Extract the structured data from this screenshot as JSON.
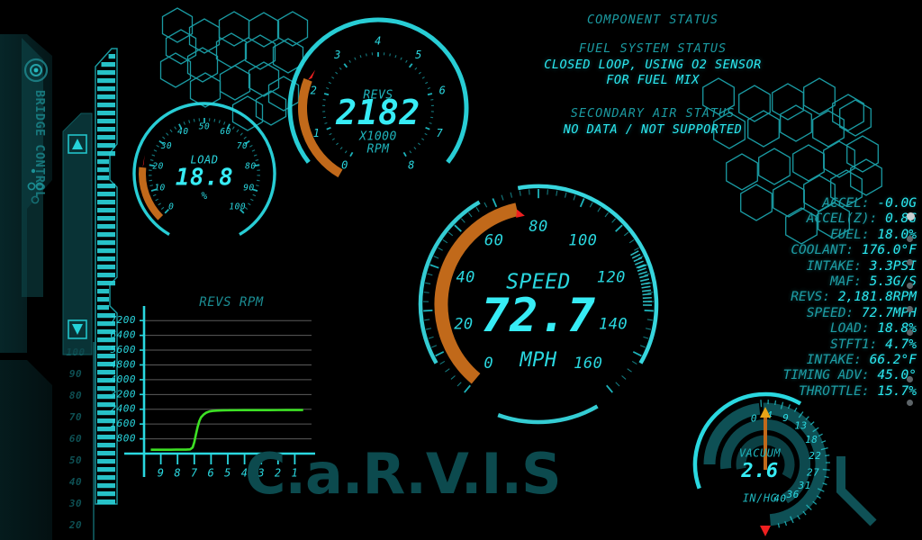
{
  "app": {
    "watermark": "C.a.R.V.I.S",
    "left_panel_label": "BRIDGE CONTROL"
  },
  "status": {
    "heading": "COMPONENT STATUS",
    "fuel_label": "FUEL SYSTEM STATUS",
    "fuel_value_line1": "CLOSED LOOP, USING O2 SENSOR",
    "fuel_value_line2": "FOR FUEL MIX",
    "air_label": "SECONDARY AIR STATUS",
    "air_value": "NO DATA / NOT SUPPORTED"
  },
  "gauges": {
    "load": {
      "title": "LOAD",
      "value": "18.8",
      "unit": "%",
      "min": 0,
      "max": 100,
      "current": 18.8,
      "ticks": [
        "0",
        "10",
        "20",
        "30",
        "40",
        "50",
        "60",
        "70",
        "80",
        "90",
        "100"
      ]
    },
    "revs": {
      "title": "REVS",
      "value": "2182",
      "unit_line1": "X1000",
      "unit_line2": "RPM",
      "min": 0,
      "max": 8,
      "current": 2.182,
      "ticks": [
        "0",
        "1",
        "2",
        "3",
        "4",
        "5",
        "6",
        "7",
        "8"
      ]
    },
    "speed": {
      "title": "SPEED",
      "value": "72.7",
      "unit": "MPH",
      "min": 0,
      "max": 160,
      "current": 72.7,
      "ticks": [
        "0",
        "20",
        "40",
        "60",
        "80",
        "100",
        "120",
        "140",
        "160"
      ]
    },
    "vacuum": {
      "title": "VACUUM",
      "value": "2.6",
      "unit": "IN/HG",
      "min": 0,
      "max": 40,
      "current": 2.6,
      "ticks": [
        "0",
        "4",
        "9",
        "13",
        "18",
        "22",
        "27",
        "31",
        "36",
        "40"
      ]
    }
  },
  "chart_data": {
    "type": "line",
    "title": "REVS RPM",
    "xlabel": "",
    "ylabel": "",
    "ylim": [
      0,
      7600
    ],
    "yticks": [
      800,
      1600,
      2400,
      3200,
      4000,
      4800,
      5600,
      6400,
      7200
    ],
    "xticks": [
      "9",
      "8",
      "7",
      "6",
      "5",
      "4",
      "3",
      "2",
      "1"
    ],
    "grid": true,
    "legend": "none",
    "series": [
      {
        "name": "REVS RPM",
        "color": "#3de024",
        "x": [
          9.6,
          9.3,
          9.0,
          8.7,
          8.4,
          8.1,
          7.8,
          7.5,
          7.25,
          7.1,
          7.0,
          6.9,
          6.8,
          6.7,
          6.6,
          6.45,
          6.3,
          6.1,
          5.9,
          5.6,
          5.3,
          5.0,
          4.5,
          4.0,
          3.5,
          3.0,
          2.5,
          2.0,
          1.5,
          1.0,
          0.5
        ],
        "values": [
          210,
          210,
          210,
          212,
          212,
          214,
          216,
          218,
          230,
          330,
          620,
          1050,
          1450,
          1760,
          1960,
          2110,
          2210,
          2280,
          2310,
          2330,
          2340,
          2345,
          2350,
          2352,
          2354,
          2355,
          2356,
          2357,
          2358,
          2358,
          2358
        ]
      }
    ]
  },
  "readout": {
    "rows": [
      {
        "label": "ACCEL:",
        "value": "-0.0G"
      },
      {
        "label": "ACCEL(Z):",
        "value": "0.8G"
      },
      {
        "label": "FUEL:",
        "value": "18.0%"
      },
      {
        "label": "COOLANT:",
        "value": "176.0°F"
      },
      {
        "label": "INTAKE:",
        "value": "3.3PSI"
      },
      {
        "label": "MAF:",
        "value": "5.3G/S"
      },
      {
        "label": "REVS:",
        "value": "2,181.8RPM"
      },
      {
        "label": "SPEED:",
        "value": "72.7MPH"
      },
      {
        "label": "LOAD:",
        "value": "18.8%"
      },
      {
        "label": "STFT1:",
        "value": "4.7%"
      },
      {
        "label": "INTAKE:",
        "value": "66.2°F"
      },
      {
        "label": "TIMING ADV:",
        "value": "45.0°"
      },
      {
        "label": "THROTTLE:",
        "value": "15.7%"
      }
    ]
  },
  "left_scale": {
    "ticks": [
      "100",
      "90",
      "80",
      "70",
      "60",
      "50",
      "40",
      "30",
      "20"
    ]
  },
  "colors": {
    "cyan": "#22e8f0",
    "dim_cyan": "#1b8d93",
    "orange": "#c1691a",
    "needle_red": "#ef2020",
    "chart_line": "#3de024",
    "background": "#000000",
    "watermark": "#0c4a4e"
  }
}
